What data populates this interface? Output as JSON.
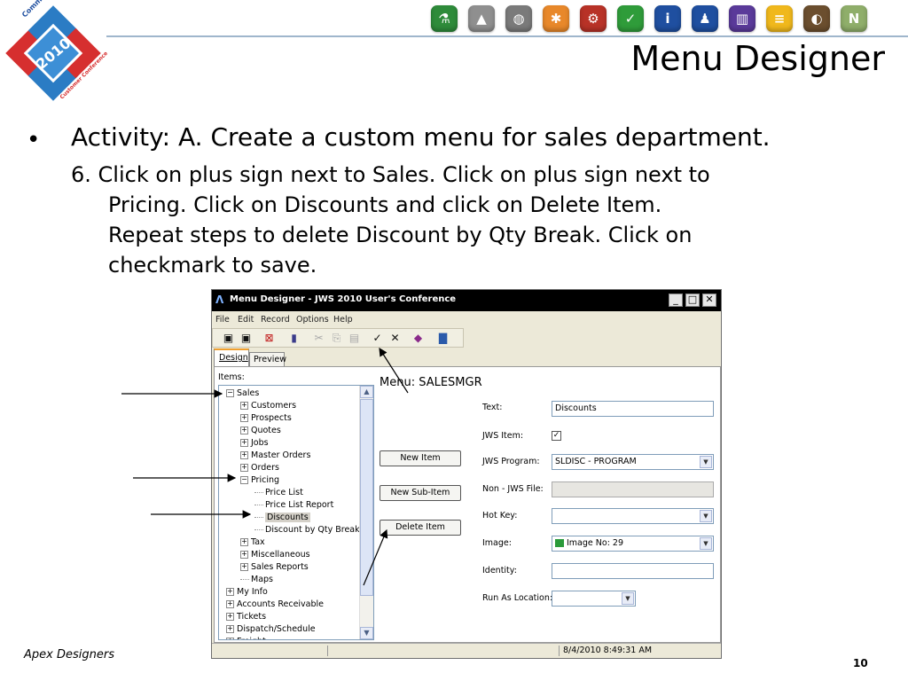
{
  "logo": {
    "ring_text_top": "Command Alkon",
    "year": "2010",
    "ring_text_bottom": "Customer Conference"
  },
  "slide": {
    "title": "Menu Designer",
    "bullet": "Activity: A. Create a custom menu for sales department.",
    "step_lines": [
      "6. Click on plus sign next to Sales.  Click on plus sign next to",
      "Pricing.  Click on Discounts and click on Delete Item.",
      "Repeat steps to delete Discount by Qty Break.  Click on",
      "checkmark to save."
    ],
    "footer": "Apex Designers",
    "page_number": "10"
  },
  "top_icons": [
    {
      "name": "flask-icon",
      "color": "#2e8b3a",
      "glyph": "⚗"
    },
    {
      "name": "truck-icon",
      "color": "#8f8f8f",
      "glyph": "▲"
    },
    {
      "name": "globe-icon",
      "color": "#7a7a7a",
      "glyph": "◍"
    },
    {
      "name": "puzzle-icon",
      "color": "#e8882a",
      "glyph": "✱"
    },
    {
      "name": "gears-icon",
      "color": "#b83227",
      "glyph": "⚙"
    },
    {
      "name": "checkmark-icon",
      "color": "#2f9c3a",
      "glyph": "✓"
    },
    {
      "name": "info-icon",
      "color": "#1f4fa0",
      "glyph": "i"
    },
    {
      "name": "person-icon",
      "color": "#1f4fa0",
      "glyph": "♟"
    },
    {
      "name": "book-icon",
      "color": "#5a3a9a",
      "glyph": "▥"
    },
    {
      "name": "document-icon",
      "color": "#f0b81c",
      "glyph": "≡"
    },
    {
      "name": "cement-mixer-icon",
      "color": "#6b4e2e",
      "glyph": "◐"
    },
    {
      "name": "n-badge-icon",
      "color": "#8fae6a",
      "glyph": "N"
    }
  ],
  "window": {
    "title": "Menu Designer - JWS 2010 User's Conference",
    "menu": [
      "File",
      "Edit",
      "Record",
      "Options",
      "Help"
    ],
    "tabs": [
      "Design",
      "Preview"
    ],
    "items_label": "Items:",
    "menu_label": "Menu: SALESMGR",
    "tree": [
      {
        "label": "Sales",
        "level": 0,
        "expander": "−"
      },
      {
        "label": "Customers",
        "level": 1,
        "expander": "+"
      },
      {
        "label": "Prospects",
        "level": 1,
        "expander": "+"
      },
      {
        "label": "Quotes",
        "level": 1,
        "expander": "+"
      },
      {
        "label": "Jobs",
        "level": 1,
        "expander": "+"
      },
      {
        "label": "Master Orders",
        "level": 1,
        "expander": "+"
      },
      {
        "label": "Orders",
        "level": 1,
        "expander": "+"
      },
      {
        "label": "Pricing",
        "level": 1,
        "expander": "−"
      },
      {
        "label": "Price List",
        "level": 2,
        "expander": ""
      },
      {
        "label": "Price List Report",
        "level": 2,
        "expander": ""
      },
      {
        "label": "Discounts",
        "level": 2,
        "expander": "",
        "selected": true
      },
      {
        "label": "Discount by Qty Break",
        "level": 2,
        "expander": ""
      },
      {
        "label": "Tax",
        "level": 1,
        "expander": "+"
      },
      {
        "label": "Miscellaneous",
        "level": 1,
        "expander": "+"
      },
      {
        "label": "Sales Reports",
        "level": 1,
        "expander": "+"
      },
      {
        "label": "Maps",
        "level": 1,
        "expander": ""
      },
      {
        "label": "My Info",
        "level": 0,
        "expander": "+"
      },
      {
        "label": "Accounts Receivable",
        "level": 0,
        "expander": "+"
      },
      {
        "label": "Tickets",
        "level": 0,
        "expander": "+"
      },
      {
        "label": "Dispatch/Schedule",
        "level": 0,
        "expander": "+"
      },
      {
        "label": "Freight",
        "level": 0,
        "expander": "+"
      }
    ],
    "buttons": {
      "new_item": "New Item",
      "new_sub_item": "New Sub-Item",
      "delete_item": "Delete Item"
    },
    "fields": {
      "text_label": "Text:",
      "text_value": "Discounts",
      "jws_item_label": "JWS Item:",
      "jws_item_checked": true,
      "jws_program_label": "JWS Program:",
      "jws_program_value": "SLDISC - PROGRAM",
      "non_jws_label": "Non - JWS File:",
      "non_jws_value": "",
      "hotkey_label": "Hot Key:",
      "hotkey_value": "",
      "image_label": "Image:",
      "image_value": "Image No: 29",
      "identity_label": "Identity:",
      "identity_value": "",
      "run_as_label": "Run As Location:",
      "run_as_value": ""
    },
    "status_time": "8/4/2010 8:49:31 AM"
  },
  "colors": {
    "arrow": "#000000",
    "titlebar": "#000000",
    "selection": "#d4d0c8"
  }
}
